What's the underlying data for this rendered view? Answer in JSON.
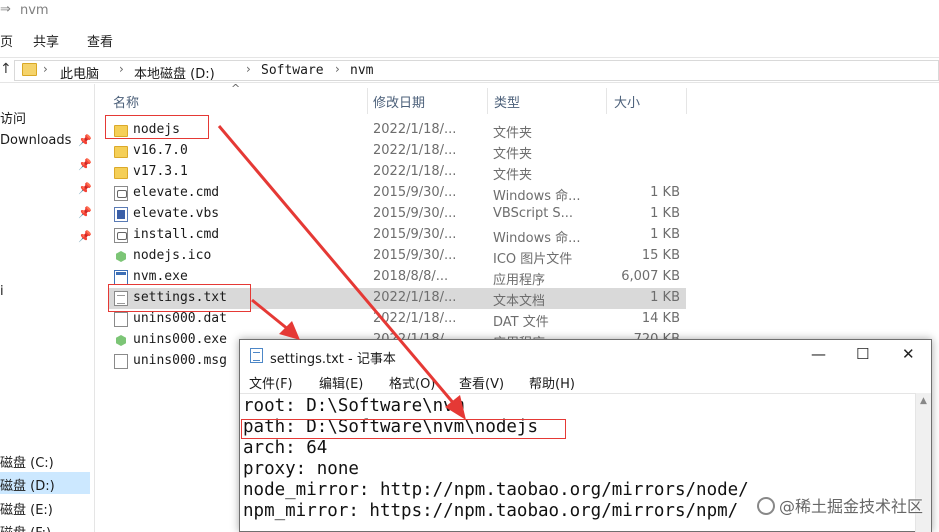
{
  "window": {
    "title": "nvm",
    "back_arrow": "⇒"
  },
  "ribbon": {
    "tabs": [
      "页",
      "共享",
      "查看"
    ]
  },
  "address": {
    "up_glyph": "↑",
    "crumbs": [
      "此电脑",
      "本地磁盘 (D:)",
      "Software",
      "nvm"
    ]
  },
  "nav": {
    "items": [
      {
        "label": "访问",
        "pinned": false
      },
      {
        "label": "Downloads",
        "pinned": true
      },
      {
        "label": "",
        "pinned": true
      },
      {
        "label": "",
        "pinned": true
      },
      {
        "label": "",
        "pinned": true
      },
      {
        "label": "",
        "pinned": true
      },
      {
        "label": "i",
        "pinned": false
      },
      {
        "label": "磁盘 (C:)",
        "pinned": false
      },
      {
        "label": "磁盘 (D:)",
        "pinned": false,
        "selected": true
      },
      {
        "label": "磁盘 (E:)",
        "pinned": false
      },
      {
        "label": "磁盘 (F:)",
        "pinned": false
      }
    ]
  },
  "columns": {
    "name": "名称",
    "date": "修改日期",
    "type": "类型",
    "size": "大小"
  },
  "files": [
    {
      "icon": "folder",
      "name": "nodejs",
      "date": "2022/1/18/...",
      "type": "文件夹",
      "size": ""
    },
    {
      "icon": "folder",
      "name": "v16.7.0",
      "date": "2022/1/18/...",
      "type": "文件夹",
      "size": ""
    },
    {
      "icon": "folder",
      "name": "v17.3.1",
      "date": "2022/1/18/...",
      "type": "文件夹",
      "size": ""
    },
    {
      "icon": "cmd",
      "name": "elevate.cmd",
      "date": "2015/9/30/...",
      "type": "Windows 命...",
      "size": "1 KB"
    },
    {
      "icon": "vbs",
      "name": "elevate.vbs",
      "date": "2015/9/30/...",
      "type": "VBScript S...",
      "size": "1 KB"
    },
    {
      "icon": "cmd",
      "name": "install.cmd",
      "date": "2015/9/30/...",
      "type": "Windows 命...",
      "size": "1 KB"
    },
    {
      "icon": "ico",
      "name": "nodejs.ico",
      "date": "2015/9/30/...",
      "type": "ICO 图片文件",
      "size": "15 KB"
    },
    {
      "icon": "exe",
      "name": "nvm.exe",
      "date": "2018/8/8/...",
      "type": "应用程序",
      "size": "6,007 KB"
    },
    {
      "icon": "txt",
      "name": "settings.txt",
      "date": "2022/1/18/...",
      "type": "文本文档",
      "size": "1 KB",
      "highlighted": true
    },
    {
      "icon": "file",
      "name": "unins000.dat",
      "date": "2022/1/18/...",
      "type": "DAT 文件",
      "size": "14 KB"
    },
    {
      "icon": "ico",
      "name": "unins000.exe",
      "date": "2022/1/18/...",
      "type": "应用程序",
      "size": "720 KB"
    },
    {
      "icon": "file",
      "name": "unins000.msg",
      "date": "",
      "type": "",
      "size": ""
    }
  ],
  "notepad": {
    "title": "settings.txt - 记事本",
    "controls": {
      "minimize": "—",
      "maximize": "☐",
      "close": "✕"
    },
    "menu": [
      "文件(F)",
      "编辑(E)",
      "格式(O)",
      "查看(V)",
      "帮助(H)"
    ],
    "lines": [
      "root: D:\\Software\\nvm",
      "path: D:\\Software\\nvm\\nodejs",
      "arch: 64",
      "proxy: none",
      "node_mirror: http://npm.taobao.org/mirrors/node/",
      "npm_mirror: https://npm.taobao.org/mirrors/npm/"
    ]
  },
  "watermark": "@稀土掘金技术社区",
  "colors": {
    "annotation": "#e53935",
    "selection": "#cce8ff",
    "row_highlight": "#d9d9d9",
    "folder": "#f5cf57"
  }
}
